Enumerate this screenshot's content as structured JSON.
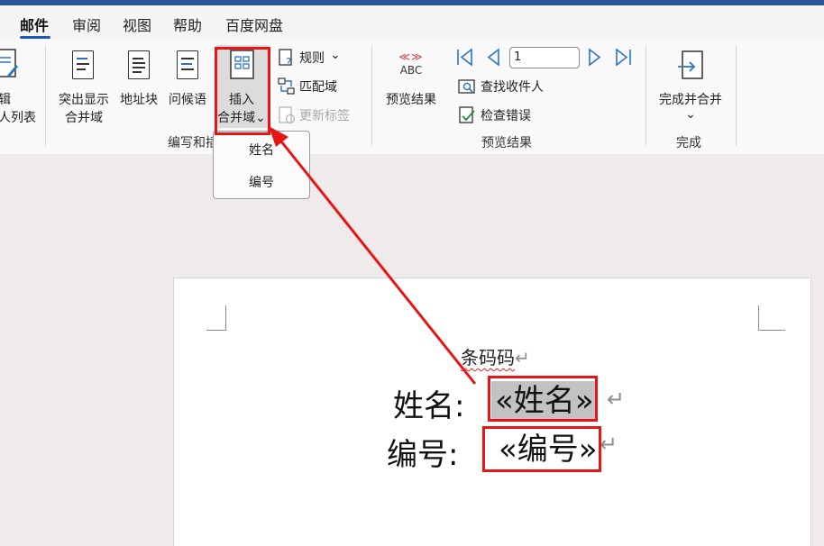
{
  "tabs": [
    {
      "label": "邮件",
      "active": true
    },
    {
      "label": "审阅"
    },
    {
      "label": "视图"
    },
    {
      "label": "帮助"
    },
    {
      "label": "百度网盘"
    }
  ],
  "ribbon": {
    "edit_recipients": {
      "line1": "辑",
      "line2": "人列表"
    },
    "highlight_fields": {
      "line1": "突出显示",
      "line2": "合并域"
    },
    "address_block": "地址块",
    "greeting_line": "问候语",
    "insert_merge_field": {
      "line1": "插入",
      "line2": "合并域",
      "chevron": "⌄"
    },
    "rules": "规则",
    "match_fields": "匹配域",
    "update_labels": "更新标签",
    "group_write_insert": "编写和插",
    "preview_results_button": "预览结果",
    "preview_icon_text": "ABC",
    "preview_icon_arrows": "≪≫",
    "record_number": "1",
    "find_recipient": "查找收件人",
    "check_errors": "检查错误",
    "group_preview": "预览结果",
    "finish_merge": "完成并合并",
    "group_finish": "完成"
  },
  "dropdown": {
    "items": [
      "姓名",
      "编号"
    ]
  },
  "document": {
    "heading": "条码码",
    "line1_label": "姓名:",
    "line1_field": "«姓名»",
    "line2_label": "编号:",
    "line2_field": "«编号»",
    "para_mark": "↵"
  },
  "colors": {
    "accent": "#2b5797",
    "highlight_red": "#e81515",
    "field_shading": "#c2c2c2"
  }
}
